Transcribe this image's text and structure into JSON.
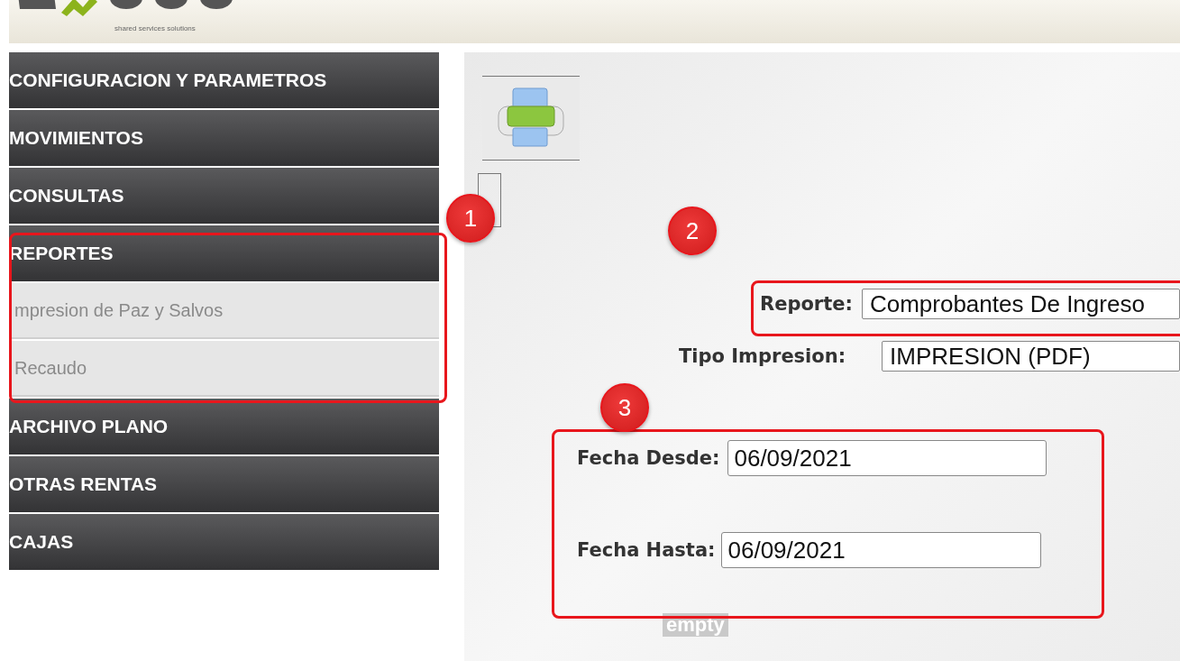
{
  "header": {
    "tagline": "shared services solutions"
  },
  "menu": [
    {
      "label": "CONFIGURACION Y PARAMETROS"
    },
    {
      "label": "MOVIMIENTOS"
    },
    {
      "label": "CONSULTAS"
    },
    {
      "label": "REPORTES",
      "children": [
        {
          "label": "mpresion de Paz y Salvos"
        },
        {
          "label": "Recaudo"
        }
      ]
    },
    {
      "label": "ARCHIVO PLANO"
    },
    {
      "label": "OTRAS RENTAS"
    },
    {
      "label": "CAJAS"
    }
  ],
  "form": {
    "reporte": {
      "label": "Reporte:",
      "value": "Comprobantes De Ingreso"
    },
    "tipo_impresion": {
      "label": "Tipo Impresion:",
      "value": "IMPRESION (PDF)"
    },
    "fecha_desde": {
      "label": "Fecha Desde:",
      "value": "06/09/2021"
    },
    "fecha_hasta": {
      "label": "Fecha Hasta:",
      "value": "06/09/2021"
    }
  },
  "footer_text": "empty",
  "callouts": [
    {
      "number": "1"
    },
    {
      "number": "2"
    },
    {
      "number": "3"
    }
  ]
}
